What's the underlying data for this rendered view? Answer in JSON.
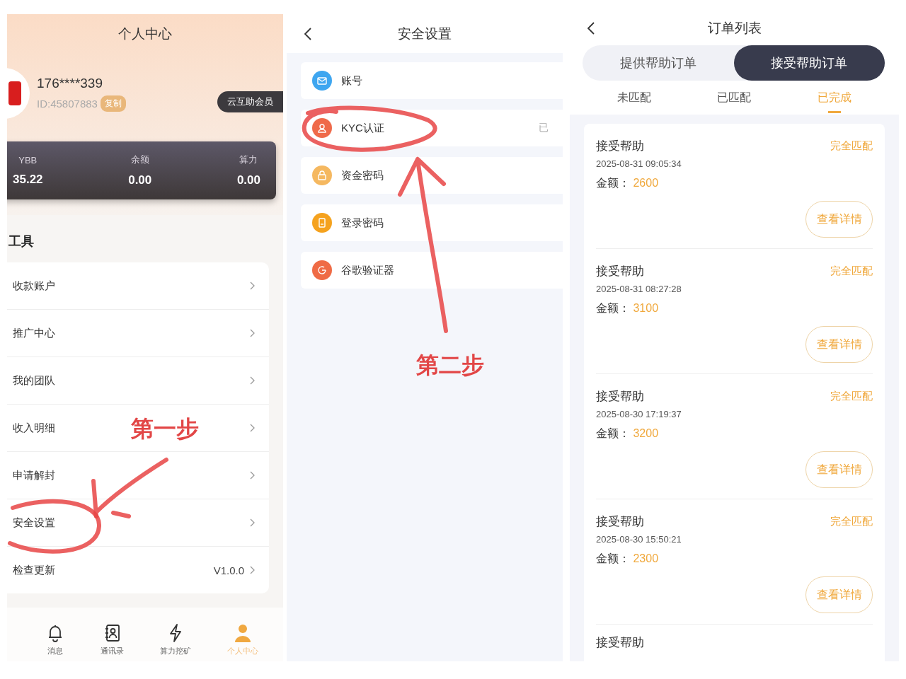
{
  "profile_screen": {
    "title": "个人中心",
    "phone": "176****339",
    "user_id": "ID:45807883",
    "copy_button": "复制",
    "member_badge": "云互助会员",
    "stats": [
      {
        "label": "YBB",
        "value": "35.22"
      },
      {
        "label": "余额",
        "value": "0.00"
      },
      {
        "label": "算力",
        "value": "0.00"
      }
    ],
    "section_title": "工具",
    "menu": [
      {
        "label": "收款账户"
      },
      {
        "label": "推广中心"
      },
      {
        "label": "我的团队"
      },
      {
        "label": "收入明细"
      },
      {
        "label": "申请解封"
      },
      {
        "label": "安全设置"
      },
      {
        "label": "检查更新",
        "value": "V1.0.0"
      }
    ],
    "annotation": "第一步",
    "nav": [
      {
        "label": "消息",
        "selected": false
      },
      {
        "label": "通讯录",
        "selected": false
      },
      {
        "label": "算力挖矿",
        "selected": false
      },
      {
        "label": "个人中心",
        "selected": true
      }
    ]
  },
  "security_screen": {
    "title": "安全设置",
    "items": [
      {
        "label": "账号",
        "color": "#3ea6f0"
      },
      {
        "label": "KYC认证",
        "value": "已",
        "color": "#ef6a4a"
      },
      {
        "label": "资金密码",
        "color": "#f5b860"
      },
      {
        "label": "登录密码",
        "color": "#f5a21e"
      },
      {
        "label": "谷歌验证器",
        "color": "#ef6b45"
      }
    ],
    "annotation": "第二步"
  },
  "orders_screen": {
    "title": "订单列表",
    "segments": [
      {
        "label": "提供帮助订单",
        "selected": false
      },
      {
        "label": "接受帮助订单",
        "selected": true
      }
    ],
    "tabs": [
      {
        "label": "未匹配",
        "selected": false
      },
      {
        "label": "已匹配",
        "selected": false
      },
      {
        "label": "已完成",
        "selected": true
      }
    ],
    "orders": [
      {
        "title": "接受帮助",
        "date": "2025-08-31 09:05:34",
        "amount_label": "金额：",
        "amount": "2600",
        "status": "完全匹配",
        "button": "查看详情"
      },
      {
        "title": "接受帮助",
        "date": "2025-08-31 08:27:28",
        "amount_label": "金额：",
        "amount": "3100",
        "status": "完全匹配",
        "button": "查看详情"
      },
      {
        "title": "接受帮助",
        "date": "2025-08-30 17:19:37",
        "amount_label": "金额：",
        "amount": "3200",
        "status": "完全匹配",
        "button": "查看详情"
      },
      {
        "title": "接受帮助",
        "date": "2025-08-30 15:50:21",
        "amount_label": "金额：",
        "amount": "2300",
        "status": "完全匹配",
        "button": "查看详情"
      }
    ],
    "partial_order_title": "接受帮助"
  }
}
